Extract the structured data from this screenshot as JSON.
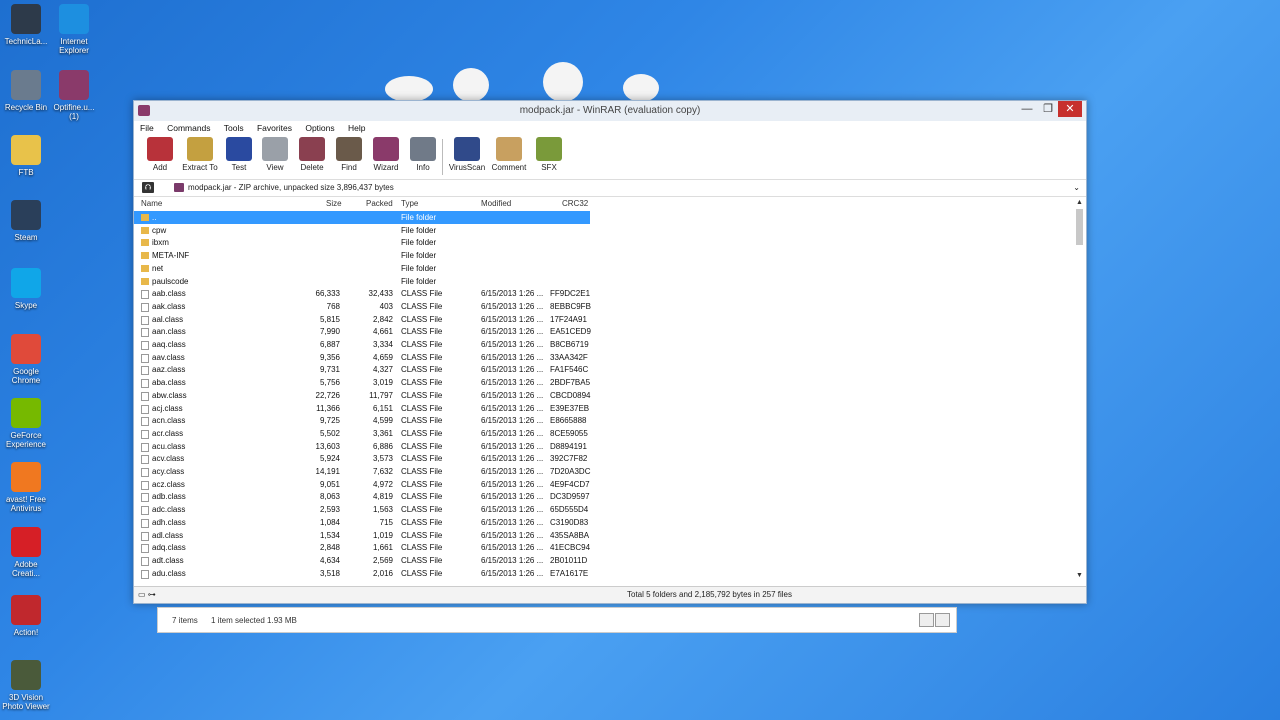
{
  "desktop": {
    "icons": [
      {
        "label": "TechnicLa...",
        "color": "#2d3a4a"
      },
      {
        "label": "Internet Explorer",
        "color": "#1d8fe0"
      },
      {
        "label": "Recycle Bin",
        "color": "#6a7b8e"
      },
      {
        "label": "Optifine.u... (1)",
        "color": "#8a3a6a"
      },
      {
        "label": "FTB",
        "color": "#e8c24a"
      },
      {
        "label": "Steam",
        "color": "#2a3f5a"
      },
      {
        "label": "Skype",
        "color": "#10a6e8"
      },
      {
        "label": "Google Chrome",
        "color": "#e04a3a"
      },
      {
        "label": "GeForce Experience",
        "color": "#76b900"
      },
      {
        "label": "avast! Free Antivirus",
        "color": "#f07820"
      },
      {
        "label": "Adobe Creati...",
        "color": "#d61f26"
      },
      {
        "label": "Action!",
        "color": "#c0282d"
      },
      {
        "label": "3D Vision Photo Viewer",
        "color": "#4a5a3a"
      }
    ]
  },
  "window": {
    "title": "modpack.jar - WinRAR (evaluation copy)",
    "minimize": "—",
    "maximize": "❐",
    "close": "✕"
  },
  "menu": [
    "File",
    "Commands",
    "Tools",
    "Favorites",
    "Options",
    "Help"
  ],
  "toolbar": [
    {
      "label": "Add",
      "color": "#b8323a"
    },
    {
      "label": "Extract To",
      "color": "#c4a040"
    },
    {
      "label": "Test",
      "color": "#2a4aa0"
    },
    {
      "label": "View",
      "color": "#9aa0a8"
    },
    {
      "label": "Delete",
      "color": "#8a4050"
    },
    {
      "label": "Find",
      "color": "#6a5a4a"
    },
    {
      "label": "Wizard",
      "color": "#8a3a6a"
    },
    {
      "label": "Info",
      "color": "#707a88"
    },
    {
      "label": "VirusScan",
      "color": "#304a8a"
    },
    {
      "label": "Comment",
      "color": "#c8a060"
    },
    {
      "label": "SFX",
      "color": "#7a9a3a"
    }
  ],
  "address": {
    "up_glyph": "⮉",
    "path": "modpack.jar - ZIP archive, unpacked size 3,896,437 bytes",
    "dropdown": "⌄"
  },
  "columns": {
    "name": "Name",
    "size": "Size",
    "packed": "Packed",
    "type": "Type",
    "modified": "Modified",
    "crc": "CRC32"
  },
  "rows": [
    {
      "name": "..",
      "size": "",
      "packed": "",
      "type": "File folder",
      "modified": "",
      "crc": "",
      "kind": "folder",
      "selected": true
    },
    {
      "name": "cpw",
      "size": "",
      "packed": "",
      "type": "File folder",
      "modified": "",
      "crc": "",
      "kind": "folder"
    },
    {
      "name": "ibxm",
      "size": "",
      "packed": "",
      "type": "File folder",
      "modified": "",
      "crc": "",
      "kind": "folder"
    },
    {
      "name": "META-INF",
      "size": "",
      "packed": "",
      "type": "File folder",
      "modified": "",
      "crc": "",
      "kind": "folder"
    },
    {
      "name": "net",
      "size": "",
      "packed": "",
      "type": "File folder",
      "modified": "",
      "crc": "",
      "kind": "folder"
    },
    {
      "name": "paulscode",
      "size": "",
      "packed": "",
      "type": "File folder",
      "modified": "",
      "crc": "",
      "kind": "folder"
    },
    {
      "name": "aab.class",
      "size": "66,333",
      "packed": "32,433",
      "type": "CLASS File",
      "modified": "6/15/2013 1:26 ...",
      "crc": "FF9DC2E1",
      "kind": "file"
    },
    {
      "name": "aak.class",
      "size": "768",
      "packed": "403",
      "type": "CLASS File",
      "modified": "6/15/2013 1:26 ...",
      "crc": "8EBBC9FB",
      "kind": "file"
    },
    {
      "name": "aal.class",
      "size": "5,815",
      "packed": "2,842",
      "type": "CLASS File",
      "modified": "6/15/2013 1:26 ...",
      "crc": "17F24A91",
      "kind": "file"
    },
    {
      "name": "aan.class",
      "size": "7,990",
      "packed": "4,661",
      "type": "CLASS File",
      "modified": "6/15/2013 1:26 ...",
      "crc": "EA51CED9",
      "kind": "file"
    },
    {
      "name": "aaq.class",
      "size": "6,887",
      "packed": "3,334",
      "type": "CLASS File",
      "modified": "6/15/2013 1:26 ...",
      "crc": "B8CB6719",
      "kind": "file"
    },
    {
      "name": "aav.class",
      "size": "9,356",
      "packed": "4,659",
      "type": "CLASS File",
      "modified": "6/15/2013 1:26 ...",
      "crc": "33AA342F",
      "kind": "file"
    },
    {
      "name": "aaz.class",
      "size": "9,731",
      "packed": "4,327",
      "type": "CLASS File",
      "modified": "6/15/2013 1:26 ...",
      "crc": "FA1F546C",
      "kind": "file"
    },
    {
      "name": "aba.class",
      "size": "5,756",
      "packed": "3,019",
      "type": "CLASS File",
      "modified": "6/15/2013 1:26 ...",
      "crc": "2BDF7BA5",
      "kind": "file"
    },
    {
      "name": "abw.class",
      "size": "22,726",
      "packed": "11,797",
      "type": "CLASS File",
      "modified": "6/15/2013 1:26 ...",
      "crc": "CBCD0894",
      "kind": "file"
    },
    {
      "name": "acj.class",
      "size": "11,366",
      "packed": "6,151",
      "type": "CLASS File",
      "modified": "6/15/2013 1:26 ...",
      "crc": "E39E37EB",
      "kind": "file"
    },
    {
      "name": "acn.class",
      "size": "9,725",
      "packed": "4,599",
      "type": "CLASS File",
      "modified": "6/15/2013 1:26 ...",
      "crc": "E8665888",
      "kind": "file"
    },
    {
      "name": "acr.class",
      "size": "5,502",
      "packed": "3,361",
      "type": "CLASS File",
      "modified": "6/15/2013 1:26 ...",
      "crc": "8CE59055",
      "kind": "file"
    },
    {
      "name": "acu.class",
      "size": "13,603",
      "packed": "6,886",
      "type": "CLASS File",
      "modified": "6/15/2013 1:26 ...",
      "crc": "D8894191",
      "kind": "file"
    },
    {
      "name": "acv.class",
      "size": "5,924",
      "packed": "3,573",
      "type": "CLASS File",
      "modified": "6/15/2013 1:26 ...",
      "crc": "392C7F82",
      "kind": "file"
    },
    {
      "name": "acy.class",
      "size": "14,191",
      "packed": "7,632",
      "type": "CLASS File",
      "modified": "6/15/2013 1:26 ...",
      "crc": "7D20A3DC",
      "kind": "file"
    },
    {
      "name": "acz.class",
      "size": "9,051",
      "packed": "4,972",
      "type": "CLASS File",
      "modified": "6/15/2013 1:26 ...",
      "crc": "4E9F4CD7",
      "kind": "file"
    },
    {
      "name": "adb.class",
      "size": "8,063",
      "packed": "4,819",
      "type": "CLASS File",
      "modified": "6/15/2013 1:26 ...",
      "crc": "DC3D9597",
      "kind": "file"
    },
    {
      "name": "adc.class",
      "size": "2,593",
      "packed": "1,563",
      "type": "CLASS File",
      "modified": "6/15/2013 1:26 ...",
      "crc": "65D555D4",
      "kind": "file"
    },
    {
      "name": "adh.class",
      "size": "1,084",
      "packed": "715",
      "type": "CLASS File",
      "modified": "6/15/2013 1:26 ...",
      "crc": "C3190D83",
      "kind": "file"
    },
    {
      "name": "adl.class",
      "size": "1,534",
      "packed": "1,019",
      "type": "CLASS File",
      "modified": "6/15/2013 1:26 ...",
      "crc": "435SA8BA",
      "kind": "file"
    },
    {
      "name": "adq.class",
      "size": "2,848",
      "packed": "1,661",
      "type": "CLASS File",
      "modified": "6/15/2013 1:26 ...",
      "crc": "41ECBC94",
      "kind": "file"
    },
    {
      "name": "adt.class",
      "size": "4,634",
      "packed": "2,569",
      "type": "CLASS File",
      "modified": "6/15/2013 1:26 ...",
      "crc": "2B01011D",
      "kind": "file"
    },
    {
      "name": "adu.class",
      "size": "3,518",
      "packed": "2,016",
      "type": "CLASS File",
      "modified": "6/15/2013 1:26 ...",
      "crc": "E7A1617E",
      "kind": "file"
    }
  ],
  "status": {
    "left": "▭ ⊶",
    "right": "Total 5 folders and 2,185,792 bytes in 257 files"
  },
  "explorer": {
    "items": "7 items",
    "selected": "1 item selected  1.93 MB"
  }
}
